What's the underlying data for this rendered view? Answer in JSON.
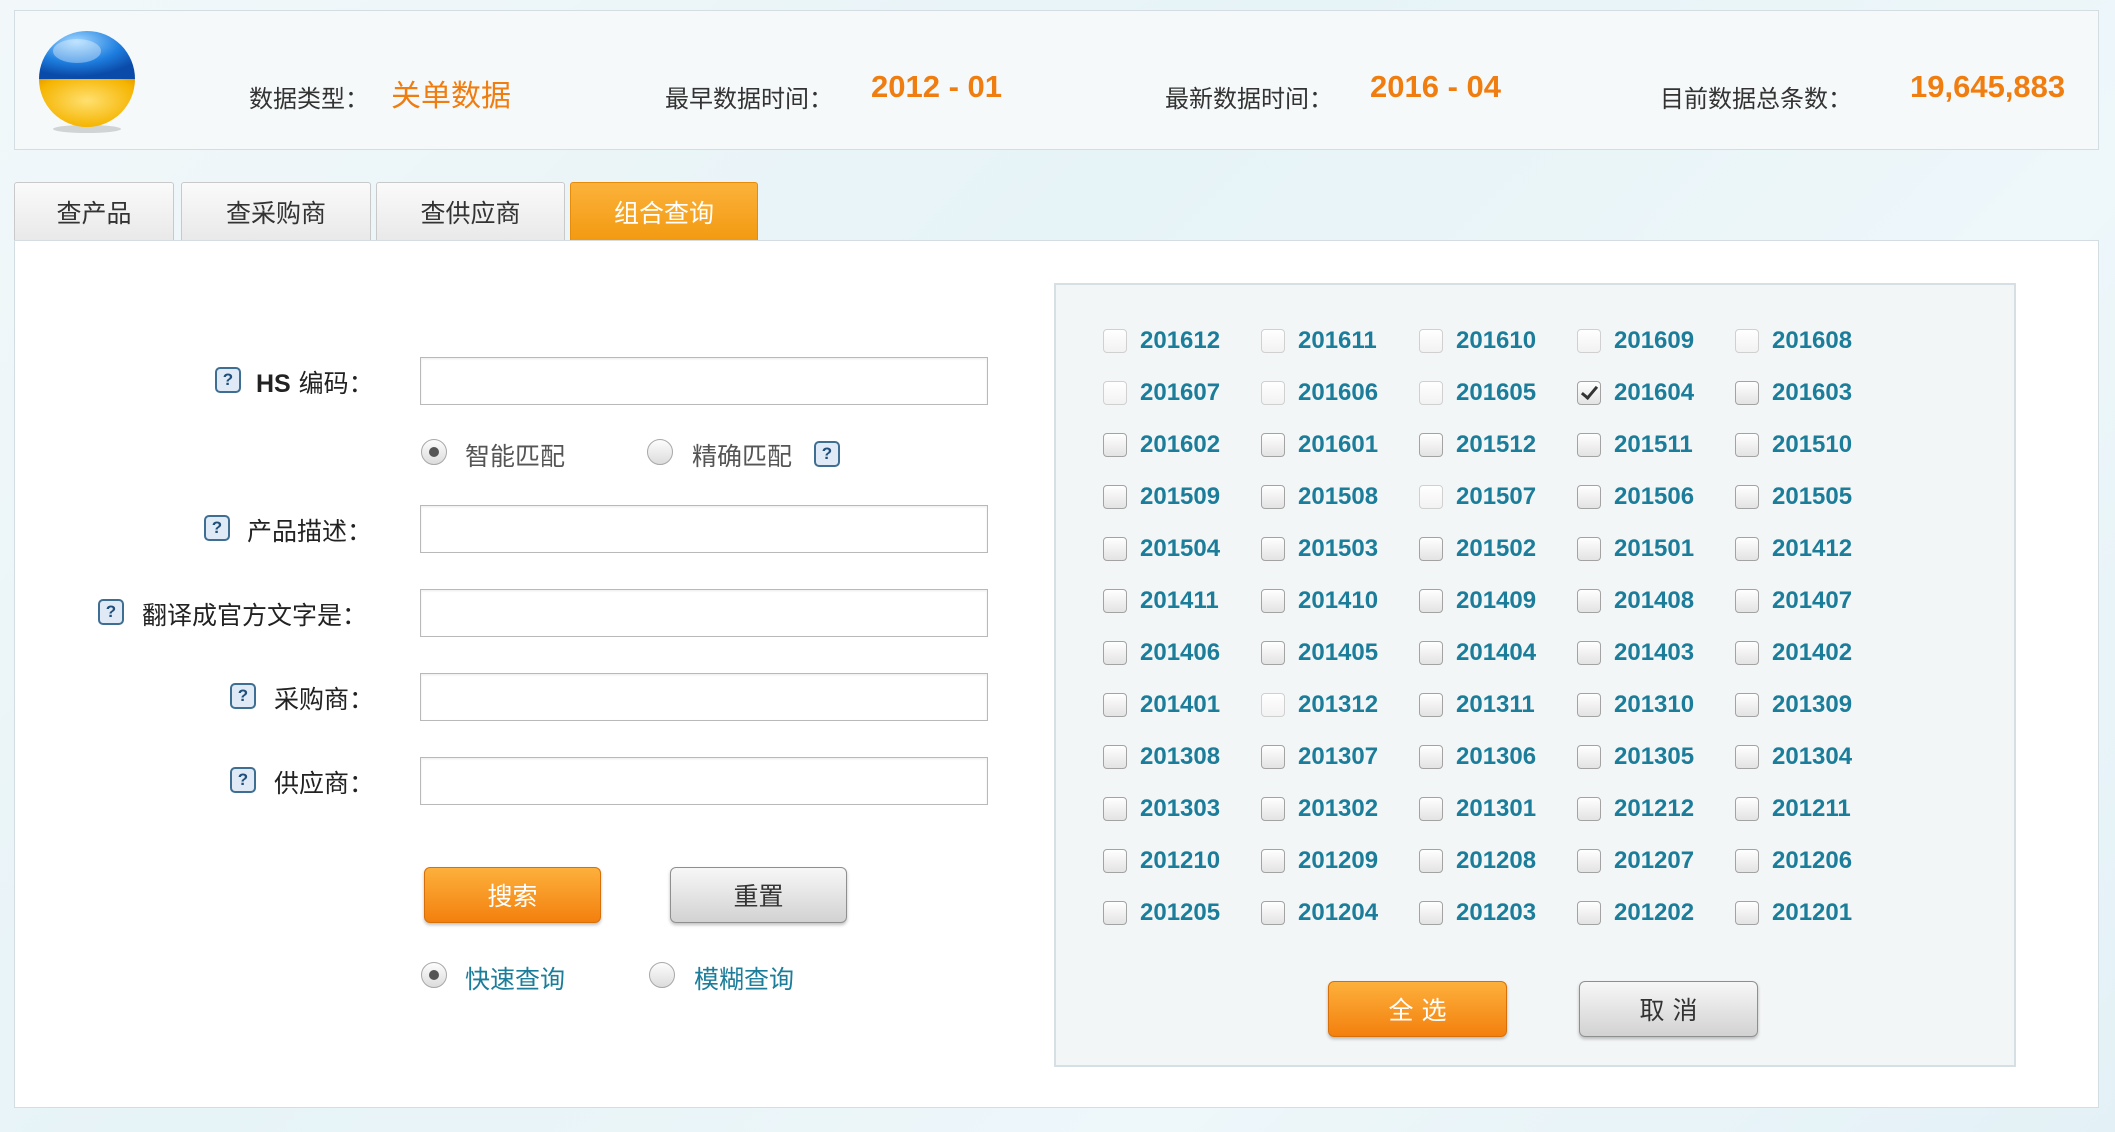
{
  "header": {
    "type_label": "数据类型：",
    "type_value": "关单数据",
    "earliest_label": "最早数据时间：",
    "earliest_value": "2012 - 01",
    "latest_label": "最新数据时间：",
    "latest_value": "2016 - 04",
    "total_label": "目前数据总条数：",
    "total_value": "19,645,883"
  },
  "tabs": [
    {
      "label": "查产品",
      "active": false
    },
    {
      "label": "查采购商",
      "active": false
    },
    {
      "label": "查供应商",
      "active": false
    },
    {
      "label": "组合查询",
      "active": true
    }
  ],
  "help_glyph": "?",
  "form": {
    "hs_code": {
      "label_code": "HS",
      "label_rest": " 编码：",
      "value": ""
    },
    "match_options": [
      {
        "label": "智能匹配",
        "selected": true
      },
      {
        "label": "精确匹配",
        "selected": false
      }
    ],
    "product_desc": {
      "label": "产品描述：",
      "value": ""
    },
    "translate": {
      "label": "翻译成官方文字是：",
      "value": ""
    },
    "buyer": {
      "label": "采购商：",
      "value": ""
    },
    "supplier": {
      "label": "供应商：",
      "value": ""
    },
    "search_button": "搜索",
    "reset_button": "重置",
    "query_modes": [
      {
        "label": "快速查询",
        "selected": true
      },
      {
        "label": "模糊查询",
        "selected": false
      }
    ]
  },
  "months": {
    "items": [
      {
        "label": "201612",
        "checked": false,
        "available": false
      },
      {
        "label": "201611",
        "checked": false,
        "available": false
      },
      {
        "label": "201610",
        "checked": false,
        "available": false
      },
      {
        "label": "201609",
        "checked": false,
        "available": false
      },
      {
        "label": "201608",
        "checked": false,
        "available": false
      },
      {
        "label": "201607",
        "checked": false,
        "available": false
      },
      {
        "label": "201606",
        "checked": false,
        "available": false
      },
      {
        "label": "201605",
        "checked": false,
        "available": false
      },
      {
        "label": "201604",
        "checked": true,
        "available": true
      },
      {
        "label": "201603",
        "checked": false,
        "available": true
      },
      {
        "label": "201602",
        "checked": false,
        "available": true
      },
      {
        "label": "201601",
        "checked": false,
        "available": true
      },
      {
        "label": "201512",
        "checked": false,
        "available": true
      },
      {
        "label": "201511",
        "checked": false,
        "available": true
      },
      {
        "label": "201510",
        "checked": false,
        "available": true
      },
      {
        "label": "201509",
        "checked": false,
        "available": true
      },
      {
        "label": "201508",
        "checked": false,
        "available": true
      },
      {
        "label": "201507",
        "checked": false,
        "available": false
      },
      {
        "label": "201506",
        "checked": false,
        "available": true
      },
      {
        "label": "201505",
        "checked": false,
        "available": true
      },
      {
        "label": "201504",
        "checked": false,
        "available": true
      },
      {
        "label": "201503",
        "checked": false,
        "available": true
      },
      {
        "label": "201502",
        "checked": false,
        "available": true
      },
      {
        "label": "201501",
        "checked": false,
        "available": true
      },
      {
        "label": "201412",
        "checked": false,
        "available": true
      },
      {
        "label": "201411",
        "checked": false,
        "available": true
      },
      {
        "label": "201410",
        "checked": false,
        "available": true
      },
      {
        "label": "201409",
        "checked": false,
        "available": true
      },
      {
        "label": "201408",
        "checked": false,
        "available": true
      },
      {
        "label": "201407",
        "checked": false,
        "available": true
      },
      {
        "label": "201406",
        "checked": false,
        "available": true
      },
      {
        "label": "201405",
        "checked": false,
        "available": true
      },
      {
        "label": "201404",
        "checked": false,
        "available": true
      },
      {
        "label": "201403",
        "checked": false,
        "available": true
      },
      {
        "label": "201402",
        "checked": false,
        "available": true
      },
      {
        "label": "201401",
        "checked": false,
        "available": true
      },
      {
        "label": "201312",
        "checked": false,
        "available": false
      },
      {
        "label": "201311",
        "checked": false,
        "available": true
      },
      {
        "label": "201310",
        "checked": false,
        "available": true
      },
      {
        "label": "201309",
        "checked": false,
        "available": true
      },
      {
        "label": "201308",
        "checked": false,
        "available": true
      },
      {
        "label": "201307",
        "checked": false,
        "available": true
      },
      {
        "label": "201306",
        "checked": false,
        "available": true
      },
      {
        "label": "201305",
        "checked": false,
        "available": true
      },
      {
        "label": "201304",
        "checked": false,
        "available": true
      },
      {
        "label": "201303",
        "checked": false,
        "available": true
      },
      {
        "label": "201302",
        "checked": false,
        "available": true
      },
      {
        "label": "201301",
        "checked": false,
        "available": true
      },
      {
        "label": "201212",
        "checked": false,
        "available": true
      },
      {
        "label": "201211",
        "checked": false,
        "available": true
      },
      {
        "label": "201210",
        "checked": false,
        "available": true
      },
      {
        "label": "201209",
        "checked": false,
        "available": true
      },
      {
        "label": "201208",
        "checked": false,
        "available": true
      },
      {
        "label": "201207",
        "checked": false,
        "available": true
      },
      {
        "label": "201206",
        "checked": false,
        "available": true
      },
      {
        "label": "201205",
        "checked": false,
        "available": true
      },
      {
        "label": "201204",
        "checked": false,
        "available": true
      },
      {
        "label": "201203",
        "checked": false,
        "available": true
      },
      {
        "label": "201202",
        "checked": false,
        "available": true
      },
      {
        "label": "201201",
        "checked": false,
        "available": true
      }
    ],
    "select_all_button": "全 选",
    "cancel_button": "取 消"
  },
  "colors": {
    "accent_orange": "#f07d0f",
    "month_text": "#1b7d9a",
    "help_border": "#3f6e93"
  },
  "icons": {
    "logo": "globe-logo-icon",
    "help": "help-question-icon",
    "checkmark": "checkmark-icon"
  }
}
